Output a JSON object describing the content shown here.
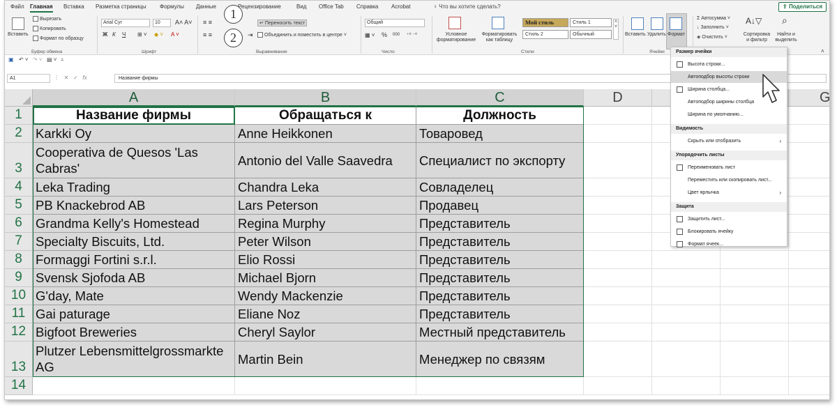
{
  "tabs": [
    "Файл",
    "Главная",
    "Вставка",
    "Разметка страницы",
    "Формулы",
    "Данные",
    "Рецензирование",
    "Вид",
    "Office Tab",
    "Справка",
    "Acrobat"
  ],
  "active_tab": "Главная",
  "tell_me": "Что вы хотите сделать?",
  "share": "Поделиться",
  "ribbon": {
    "clipboard": {
      "paste": "Вставить",
      "cut": "Вырезать",
      "copy": "Копировать",
      "format_painter": "Формат по образцу",
      "label": "Буфер обмена"
    },
    "font": {
      "name": "Arial Cyr",
      "size": "10",
      "label": "Шрифт",
      "bold": "Ж",
      "italic": "К",
      "underline": "Ч"
    },
    "alignment": {
      "wrap": "Переносить текст",
      "merge": "Объединить и поместить в центре",
      "label": "Выравнивание"
    },
    "number": {
      "format": "Общий",
      "percent": "%",
      "thousands": "000",
      "label": "Число"
    },
    "styles": {
      "conditional": "Условное форматирование",
      "table": "Форматировать как таблицу",
      "my_style": "Мой стиль",
      "style1": "Стиль 1",
      "style2": "Стиль 2",
      "normal": "Обычный",
      "label": "Стили"
    },
    "cells": {
      "insert": "Вставить",
      "delete": "Удалить",
      "format": "Формат",
      "label": "Ячейки"
    },
    "editing": {
      "autosum": "Автосумма",
      "fill": "Заполнить",
      "clear": "Очистить",
      "sort": "Сортировка и фильтр",
      "find": "Найти и выделить"
    }
  },
  "annotations": [
    "1",
    "2"
  ],
  "formula_bar": {
    "cell_ref": "A1",
    "fx": "fx",
    "content": "Название фирмы"
  },
  "columns": [
    "A",
    "B",
    "C",
    "D",
    "E",
    "F",
    "G"
  ],
  "rows": [
    {
      "num": "1",
      "a": "Название фирмы",
      "b": "Обращаться к",
      "c": "Должность"
    },
    {
      "num": "2",
      "a": "Karkki Oy",
      "b": "Anne Heikkonen",
      "c": "Товаровед"
    },
    {
      "num": "3",
      "a": "Cooperativa de Quesos 'Las Cabras'",
      "b": "Antonio del Valle Saavedra",
      "c": "Специалист по экспорту"
    },
    {
      "num": "4",
      "a": "Leka Trading",
      "b": "Chandra Leka",
      "c": "Совладелец"
    },
    {
      "num": "5",
      "a": "PB Knackebrod AB",
      "b": "Lars Peterson",
      "c": "Продавец"
    },
    {
      "num": "6",
      "a": "Grandma Kelly's Homestead",
      "b": "Regina Murphy",
      "c": "Представитель"
    },
    {
      "num": "7",
      "a": "Specialty Biscuits, Ltd.",
      "b": "Peter Wilson",
      "c": "Представитель"
    },
    {
      "num": "8",
      "a": "Formaggi Fortini s.r.l.",
      "b": "Elio Rossi",
      "c": "Представитель"
    },
    {
      "num": "9",
      "a": "Svensk Sjofoda AB",
      "b": "Michael Bjorn",
      "c": "Представитель"
    },
    {
      "num": "10",
      "a": "G'day, Mate",
      "b": "Wendy Mackenzie",
      "c": "Представитель"
    },
    {
      "num": "11",
      "a": "Gai paturage",
      "b": "Eliane Noz",
      "c": "Представитель"
    },
    {
      "num": "12",
      "a": "Bigfoot Breweries",
      "b": "Cheryl Saylor",
      "c": "Местный представитель"
    },
    {
      "num": "13",
      "a": "Plutzer Lebensmittelgrossmarkte AG",
      "b": "Martin Bein",
      "c": "Менеджер по связям"
    },
    {
      "num": "14",
      "a": "",
      "b": "",
      "c": ""
    }
  ],
  "format_menu": {
    "sections": [
      {
        "title": "Размер ячейки",
        "items": [
          {
            "label": "Высота строки...",
            "icon": "row-height-icon"
          },
          {
            "label": "Автоподбор высоты строки",
            "highlight": true
          },
          {
            "label": "Ширина столбца...",
            "icon": "column-width-icon"
          },
          {
            "label": "Автоподбор ширины столбца"
          },
          {
            "label": "Ширина по умолчанию..."
          }
        ]
      },
      {
        "title": "Видимость",
        "items": [
          {
            "label": "Скрыть или отобразить",
            "submenu": true
          }
        ]
      },
      {
        "title": "Упорядочить листы",
        "items": [
          {
            "label": "Переименовать лист",
            "icon": "rename-sheet-icon"
          },
          {
            "label": "Переместить или скопировать лист..."
          },
          {
            "label": "Цвет ярлычка",
            "submenu": true
          }
        ]
      },
      {
        "title": "Защита",
        "items": [
          {
            "label": "Защитить лист...",
            "icon": "protect-sheet-icon"
          },
          {
            "label": "Блокировать ячейку",
            "icon": "lock-cell-icon"
          },
          {
            "label": "Формат ячеек...",
            "icon": "format-cells-icon"
          }
        ]
      }
    ]
  },
  "colors": {
    "accent": "#217346",
    "ribbon_bg": "#f3f3f3",
    "selection_fill": "#d9d9d9"
  }
}
